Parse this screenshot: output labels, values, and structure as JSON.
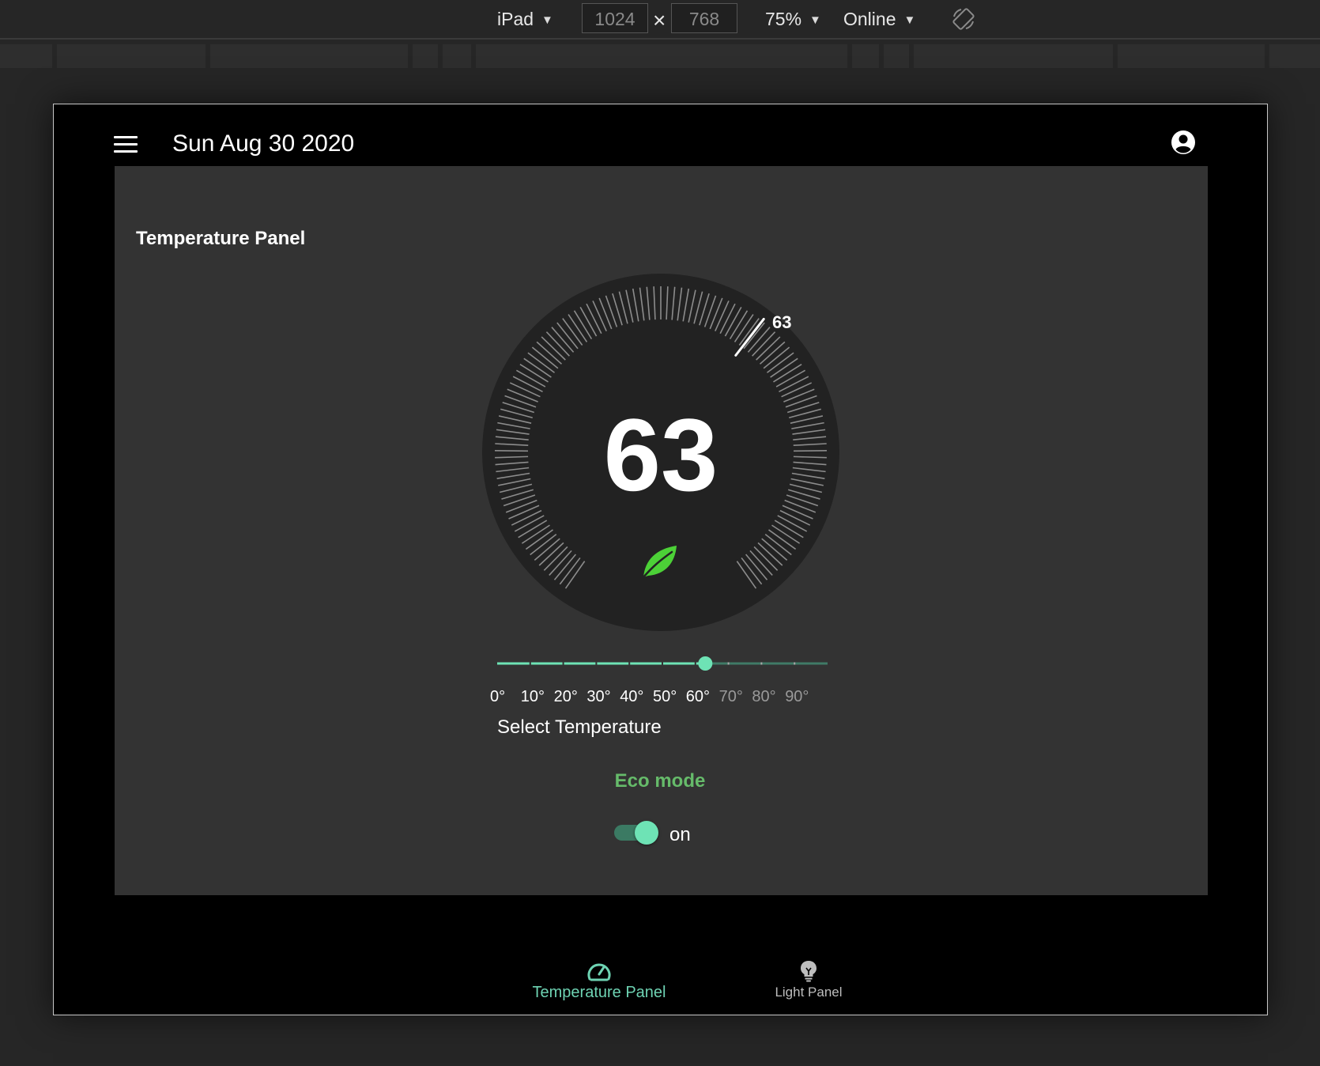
{
  "devtools": {
    "device": "iPad",
    "width": "1024",
    "height": "768",
    "times": "×",
    "zoom": "75%",
    "network": "Online",
    "caret": "▼",
    "rotate_icon": "rotate-device-icon"
  },
  "app": {
    "date": "Sun Aug 30 2020",
    "menu_icon": "menu-icon",
    "account_icon": "account-circle-icon"
  },
  "panel": {
    "title": "Temperature Panel",
    "temperature": "63",
    "marker_label": "63",
    "eco_icon": "leaf-icon",
    "slider": {
      "min": 0,
      "max": 100,
      "value": 63,
      "tick_labels": [
        "0°",
        "10°",
        "20°",
        "30°",
        "40°",
        "50°",
        "60°",
        "70°",
        "80°",
        "90°"
      ]
    },
    "select_label": "Select Temperature",
    "eco_label": "Eco mode",
    "eco_toggle": {
      "state": "on",
      "label": "on"
    }
  },
  "bottom_nav": [
    {
      "label": "Temperature Panel",
      "icon": "speedometer-icon",
      "active": true
    },
    {
      "label": "Light Panel",
      "icon": "lightbulb-icon",
      "active": false
    }
  ],
  "colors": {
    "accent": "#6ee3b5",
    "eco_green": "#66bb6a",
    "leaf": "#4cd137",
    "panel_bg": "#333333",
    "dial_bg": "#222222"
  }
}
